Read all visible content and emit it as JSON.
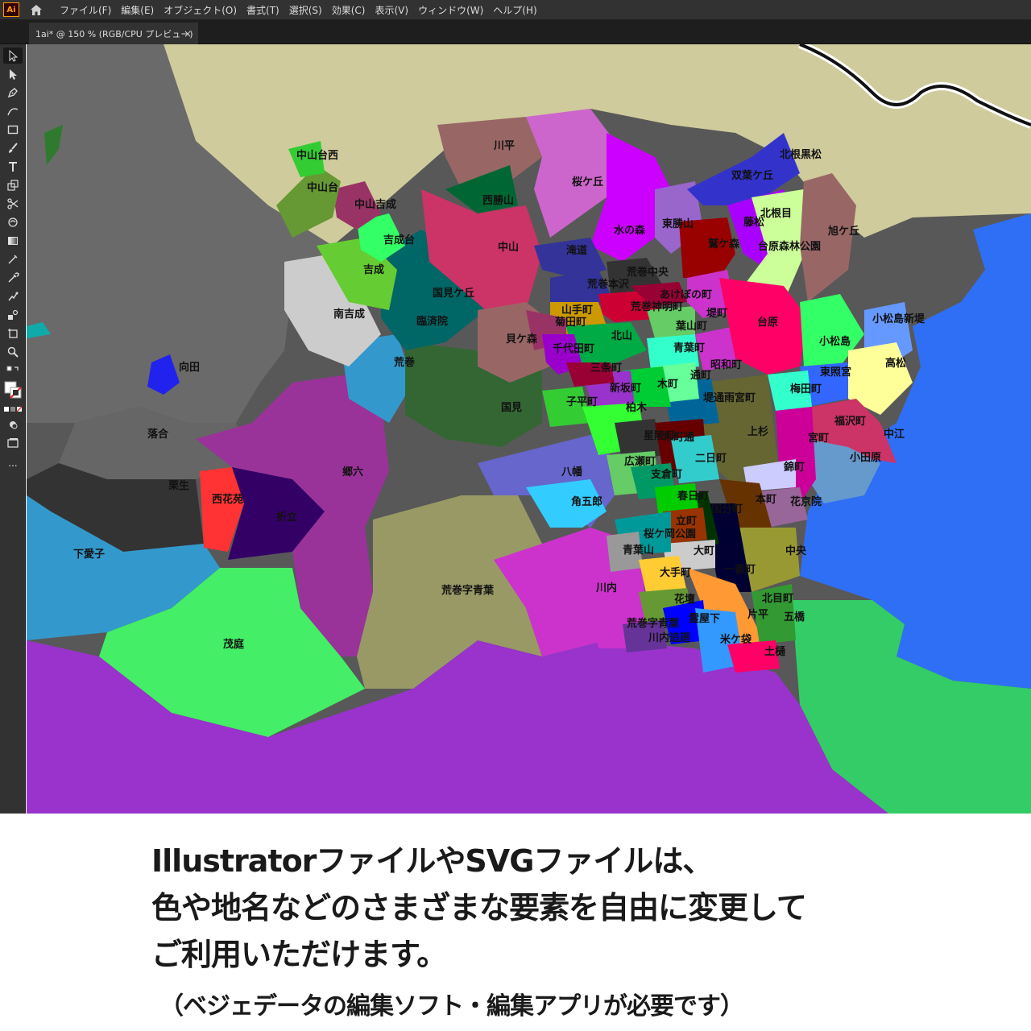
{
  "app": {
    "logo_text": "Ai",
    "menu": [
      "ファイル(F)",
      "編集(E)",
      "オブジェクト(O)",
      "書式(T)",
      "選択(S)",
      "効果(C)",
      "表示(V)",
      "ウィンドウ(W)",
      "ヘルプ(H)"
    ]
  },
  "document_tab": {
    "label": "1ai* @ 150 % (RGB/CPU プレビュー)",
    "close_symbol": "×"
  },
  "toolbar": {
    "tools": [
      "selection-tool",
      "direct-selection-tool",
      "pen-tool",
      "curvature-tool",
      "rectangle-tool",
      "paintbrush-tool",
      "type-tool",
      "rotate-tool",
      "scissors-tool",
      "warp-tool",
      "gradient-tool",
      "mesh-tool",
      "eyedropper-tool",
      "blend-tool",
      "symbol-sprayer-tool",
      "artboard-tool",
      "zoom-tool",
      "fill-stroke-swatch",
      "drawing-mode",
      "screen-mode",
      "more-tools"
    ],
    "more_label": "..."
  },
  "map": {
    "colors": {
      "sea": "#2f6ff5",
      "background_gray": "#585858",
      "tan": "#cfcb9c",
      "green_land": "#33cc66",
      "purple_south": "#9933cc"
    },
    "labels": [
      {
        "text": "中山台西"
      },
      {
        "text": "川平"
      },
      {
        "text": "桜ケ丘"
      },
      {
        "text": "北根黒松"
      },
      {
        "text": "双葉ケ丘"
      },
      {
        "text": "中山台"
      },
      {
        "text": "西勝山"
      },
      {
        "text": "東勝山"
      },
      {
        "text": "北根目"
      },
      {
        "text": "中山吉成"
      },
      {
        "text": "藤松"
      },
      {
        "text": "旭ケ丘"
      },
      {
        "text": "水の森"
      },
      {
        "text": "吉成台"
      },
      {
        "text": "中山"
      },
      {
        "text": "鷲ケ森"
      },
      {
        "text": "台原森林公園"
      },
      {
        "text": "滝道"
      },
      {
        "text": "吉成"
      },
      {
        "text": "荒巻中央"
      },
      {
        "text": "国見ケ丘"
      },
      {
        "text": "荒巻本沢"
      },
      {
        "text": "あけぼの町"
      },
      {
        "text": "南吉成"
      },
      {
        "text": "山手町"
      },
      {
        "text": "荒巻神明町"
      },
      {
        "text": "堤町"
      },
      {
        "text": "小松島新堤"
      },
      {
        "text": "臨済院"
      },
      {
        "text": "菊田町"
      },
      {
        "text": "葉山町"
      },
      {
        "text": "台原"
      },
      {
        "text": "貝ケ森"
      },
      {
        "text": "北山"
      },
      {
        "text": "小松島"
      },
      {
        "text": "千代田町"
      },
      {
        "text": "青葉町"
      },
      {
        "text": "高松"
      },
      {
        "text": "荒巻"
      },
      {
        "text": "昭和町"
      },
      {
        "text": "向田"
      },
      {
        "text": "三条町"
      },
      {
        "text": "通町"
      },
      {
        "text": "東照宮"
      },
      {
        "text": "新坂町"
      },
      {
        "text": "木町"
      },
      {
        "text": "梅田町"
      },
      {
        "text": "子平町"
      },
      {
        "text": "堤通雨宮町"
      },
      {
        "text": "国見"
      },
      {
        "text": "柏木"
      },
      {
        "text": "福沢町"
      },
      {
        "text": "上杉"
      },
      {
        "text": "中江"
      },
      {
        "text": "落合"
      },
      {
        "text": "星陵町"
      },
      {
        "text": "木町通"
      },
      {
        "text": "宮町"
      },
      {
        "text": "小田原"
      },
      {
        "text": "二日町"
      },
      {
        "text": "広瀬町"
      },
      {
        "text": "錦町"
      },
      {
        "text": "郷六"
      },
      {
        "text": "八幡"
      },
      {
        "text": "支倉町"
      },
      {
        "text": "栗生"
      },
      {
        "text": "春日町"
      },
      {
        "text": "本町"
      },
      {
        "text": "花京院"
      },
      {
        "text": "西花苑"
      },
      {
        "text": "角五郎"
      },
      {
        "text": "国分町"
      },
      {
        "text": "折立"
      },
      {
        "text": "立町"
      },
      {
        "text": "桜ケ岡公園"
      },
      {
        "text": "中央"
      },
      {
        "text": "青葉山"
      },
      {
        "text": "大町"
      },
      {
        "text": "下愛子"
      },
      {
        "text": "一番町"
      },
      {
        "text": "大手町"
      },
      {
        "text": "荒巻字青葉"
      },
      {
        "text": "川内"
      },
      {
        "text": "北目町"
      },
      {
        "text": "花壇"
      },
      {
        "text": "片平"
      },
      {
        "text": "五橋"
      },
      {
        "text": "荒巻字青葉"
      },
      {
        "text": "霊屋下"
      },
      {
        "text": "川内追廻"
      },
      {
        "text": "米ケ袋"
      },
      {
        "text": "茂庭"
      },
      {
        "text": "土樋"
      }
    ]
  },
  "caption": {
    "line1": "IllustratorファイルやSVGファイルは、",
    "line2": "色や地名などのさまざまな要素を自由に変更して",
    "line3": "ご利用いただけます。",
    "note": "（ベジェデータの編集ソフト・編集アプリが必要です）"
  }
}
